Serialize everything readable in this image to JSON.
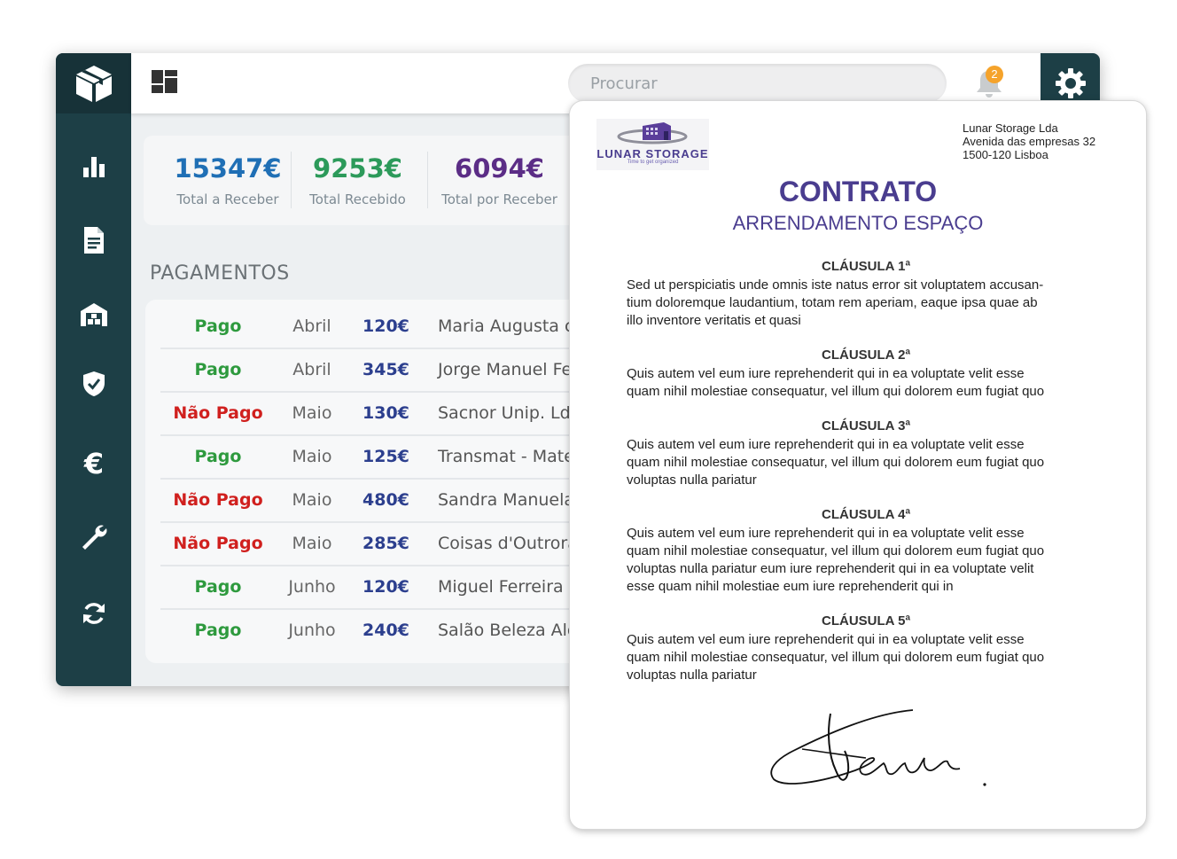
{
  "topbar": {
    "search_placeholder": "Procurar",
    "notification_count": "2"
  },
  "sidebar": {
    "items": [
      {
        "icon": "bar-chart-icon"
      },
      {
        "icon": "document-icon"
      },
      {
        "icon": "warehouse-icon"
      },
      {
        "icon": "shield-check-icon"
      },
      {
        "icon": "euro-icon"
      },
      {
        "icon": "wrench-icon"
      },
      {
        "icon": "refresh-icon"
      }
    ]
  },
  "stats": [
    {
      "value": "15347€",
      "label": "Total a Receber",
      "color": "#1f6fb5"
    },
    {
      "value": "9253€",
      "label": "Total Recebido",
      "color": "#2c9a5a"
    },
    {
      "value": "6094€",
      "label": "Total por Receber",
      "color": "#5b2d86"
    }
  ],
  "payments": {
    "title": "PAGAMENTOS",
    "rows": [
      {
        "status": "Pago",
        "month": "Abril",
        "amount": "120€",
        "name": "Maria Augusta c"
      },
      {
        "status": "Pago",
        "month": "Abril",
        "amount": "345€",
        "name": "Jorge Manuel Fe"
      },
      {
        "status": "Não Pago",
        "month": "Maio",
        "amount": "130€",
        "name": "Sacnor Unip. Ld"
      },
      {
        "status": "Pago",
        "month": "Maio",
        "amount": "125€",
        "name": "Transmat - Mate"
      },
      {
        "status": "Não Pago",
        "month": "Maio",
        "amount": "480€",
        "name": "Sandra Manuela"
      },
      {
        "status": "Não Pago",
        "month": "Maio",
        "amount": "285€",
        "name": "Coisas d'Outrora"
      },
      {
        "status": "Pago",
        "month": "Junho",
        "amount": "120€",
        "name": "Miguel Ferreira"
      },
      {
        "status": "Pago",
        "month": "Junho",
        "amount": "240€",
        "name": "Salão Beleza Alc"
      }
    ],
    "status_colors": {
      "Pago": "#2e9a3e",
      "Não Pago": "#d0201e"
    }
  },
  "contract": {
    "logo_name": "LUNAR STORAGE",
    "logo_tagline": "Time to get organized",
    "address": [
      "Lunar Storage Lda",
      "Avenida das empresas 32",
      "1500-120 Lisboa"
    ],
    "title": "CONTRATO",
    "subtitle": "ARRENDAMENTO ESPAÇO",
    "clauses": [
      {
        "heading": "CLÁUSULA 1ª",
        "lines": [
          "Sed ut perspiciatis unde omnis iste natus error sit voluptatem accusan-",
          "tium doloremque laudantium, totam rem aperiam, eaque ipsa quae ab",
          "illo inventore veritatis et quasi"
        ]
      },
      {
        "heading": "CLÁUSULA 2ª",
        "lines": [
          "Quis autem vel eum iure reprehenderit qui in ea voluptate velit esse",
          "quam nihil molestiae consequatur, vel illum qui dolorem eum fugiat quo"
        ]
      },
      {
        "heading": "CLÁUSULA 3ª",
        "lines": [
          "Quis autem vel eum iure reprehenderit qui in ea voluptate velit esse",
          "quam nihil molestiae consequatur, vel illum qui dolorem eum fugiat quo",
          "voluptas nulla pariatur"
        ]
      },
      {
        "heading": "CLÁUSULA 4ª",
        "lines": [
          "Quis autem vel eum iure reprehenderit qui in ea voluptate velit esse",
          "quam nihil molestiae consequatur, vel illum qui dolorem eum fugiat quo",
          "voluptas nulla pariatur eum iure reprehenderit qui in ea voluptate velit",
          "esse quam nihil molestiae eum iure reprehenderit qui in"
        ]
      },
      {
        "heading": "CLÁUSULA 5ª",
        "lines": [
          "Quis autem vel eum iure reprehenderit qui in ea voluptate velit esse",
          "quam nihil molestiae consequatur, vel illum qui dolorem eum fugiat quo",
          "voluptas nulla pariatur"
        ]
      }
    ]
  }
}
